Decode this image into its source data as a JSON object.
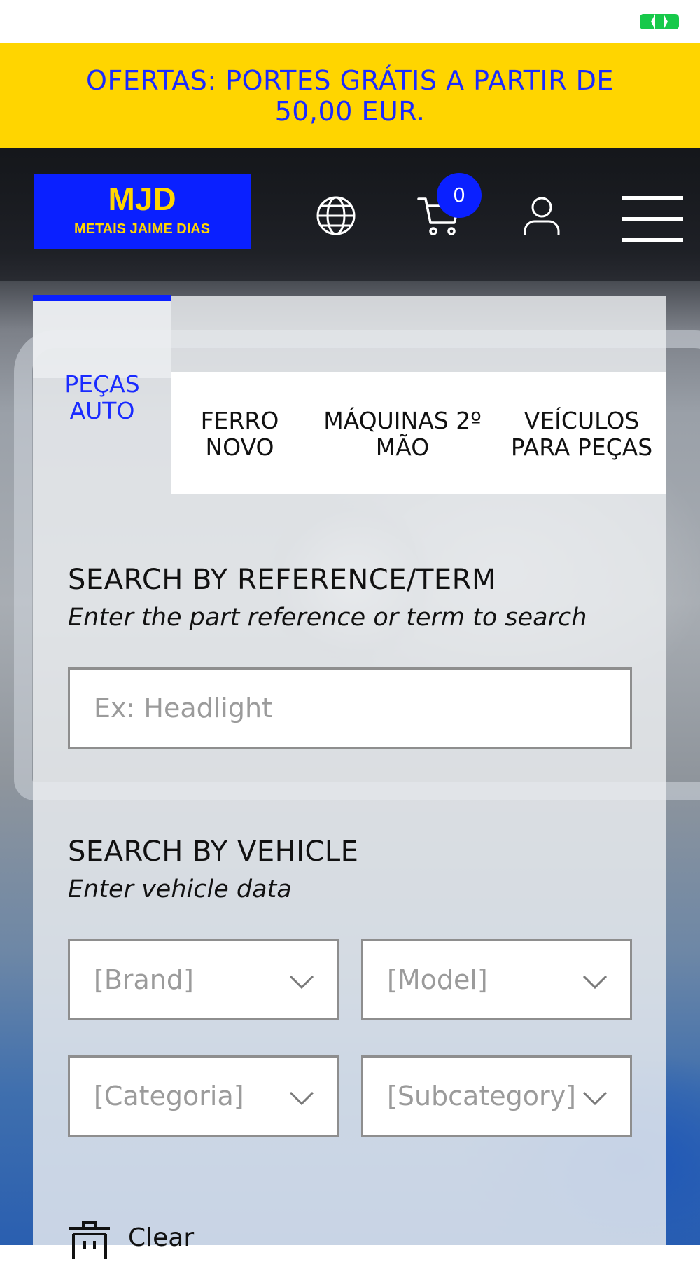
{
  "status": {
    "battery_icon": "battery-icon"
  },
  "promo": {
    "text": "OFERTAS: PORTES GRÁTIS A PARTIR DE 50,00 EUR."
  },
  "header": {
    "logo": {
      "main": "MJD",
      "sub": "METAIS JAIME DIAS"
    },
    "cart_count": "0",
    "icons": [
      "globe-icon",
      "cart-icon",
      "user-icon",
      "menu-icon"
    ]
  },
  "tabs": [
    {
      "label": "PEÇAS AUTO",
      "active": true
    },
    {
      "label": "FERRO NOVO",
      "active": false
    },
    {
      "label": "MÁQUINAS 2º MÃO",
      "active": false
    },
    {
      "label": "VEÍCULOS PARA PEÇAS",
      "active": false
    }
  ],
  "search_reference": {
    "title": "SEARCH BY REFERENCE/TERM",
    "subtitle": "Enter the part reference or term to search",
    "placeholder": "Ex: Headlight"
  },
  "search_vehicle": {
    "title": "SEARCH BY VEHICLE",
    "subtitle": "Enter vehicle data",
    "brand": "[Brand]",
    "model": "[Model]",
    "category": "[Categoria]",
    "subcategory": "[Subcategory]"
  },
  "clear": {
    "label": "Clear"
  },
  "colors": {
    "accent": "#0a20ff",
    "brand_yellow": "#ffd500",
    "promo_text": "#1a2bff"
  }
}
